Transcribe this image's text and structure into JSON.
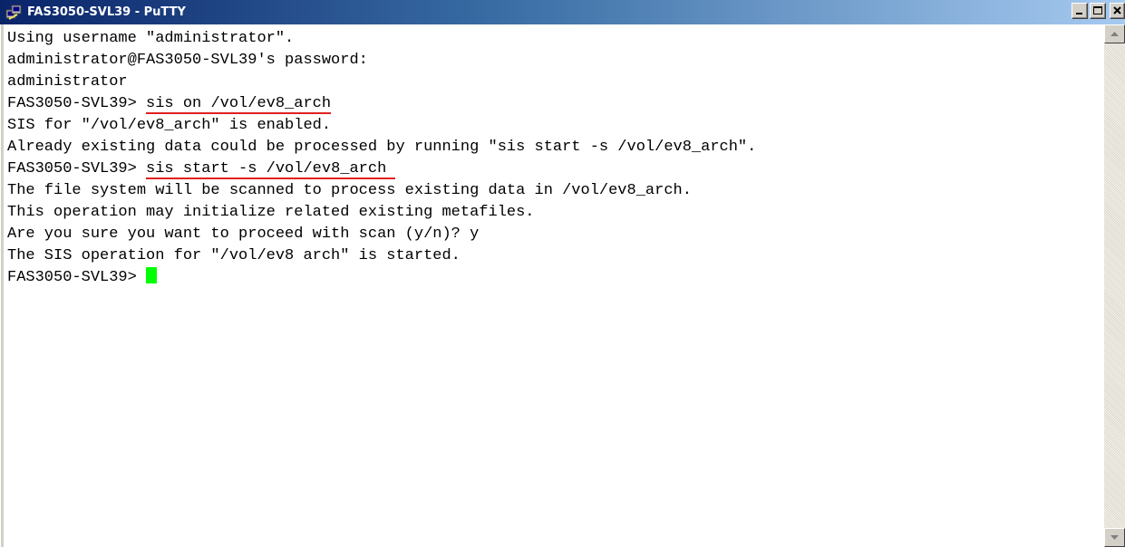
{
  "window": {
    "title": "FAS3050-SVL39 - PuTTY",
    "app_icon": "putty-icon",
    "controls": {
      "minimize_icon": "minimize-icon",
      "maximize_icon": "maximize-icon",
      "close_icon": "close-icon"
    }
  },
  "terminal": {
    "lines": [
      {
        "text": "Using username \"administrator\"."
      },
      {
        "text": "administrator@FAS3050-SVL39's password:"
      },
      {
        "text": "administrator"
      },
      {
        "prompt": "FAS3050-SVL39> ",
        "command": "sis on /vol/ev8_arch",
        "underlined": true
      },
      {
        "text": "SIS for \"/vol/ev8_arch\" is enabled."
      },
      {
        "text": "Already existing data could be processed by running \"sis start -s /vol/ev8_arch\"."
      },
      {
        "prompt": "FAS3050-SVL39> ",
        "command": "sis start -s /vol/ev8_arch ",
        "underlined": true
      },
      {
        "text": "The file system will be scanned to process existing data in /vol/ev8_arch."
      },
      {
        "text": "This operation may initialize related existing metafiles."
      },
      {
        "text": "Are you sure you want to proceed with scan (y/n)? y"
      },
      {
        "text": "The SIS operation for \"/vol/ev8 arch\" is started."
      },
      {
        "prompt": "FAS3050-SVL39> ",
        "cursor": true
      }
    ],
    "colors": {
      "background": "#ffffff",
      "foreground": "#000000",
      "cursor": "#00ff00",
      "underline": "#e02020"
    }
  },
  "scrollbar": {
    "up_icon": "scroll-up-arrow-icon",
    "down_icon": "scroll-down-arrow-icon"
  }
}
